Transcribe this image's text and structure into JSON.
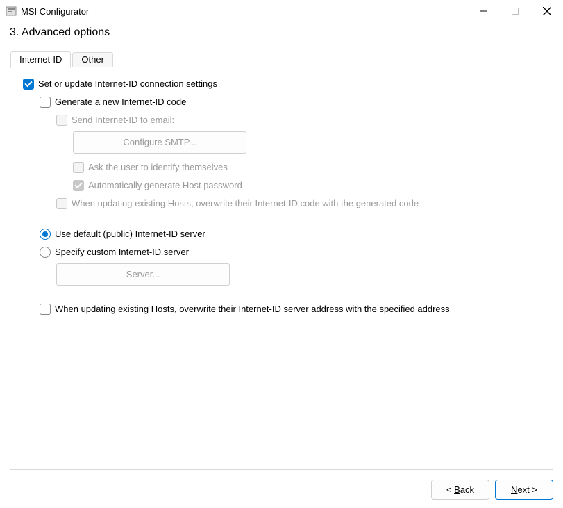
{
  "window": {
    "title": "MSI Configurator"
  },
  "heading": "3. Advanced options",
  "tabs": {
    "internet_id": "Internet-ID",
    "other": "Other"
  },
  "form": {
    "set_or_update": "Set or update Internet-ID connection settings",
    "generate_new": "Generate a new Internet-ID code",
    "send_email": "Send Internet-ID to email:",
    "configure_smtp": "Configure SMTP...",
    "ask_identify": "Ask the user to identify themselves",
    "auto_host_pw": "Automatically generate Host password",
    "overwrite_code": "When updating existing Hosts, overwrite their Internet-ID code with the generated code",
    "use_default_server": "Use default (public) Internet-ID server",
    "specify_custom_server": "Specify custom Internet-ID server",
    "server_btn": "Server...",
    "overwrite_server": "When updating existing Hosts, overwrite their Internet-ID server address with the specified address"
  },
  "footer": {
    "back": "< Back",
    "next": "Next >"
  }
}
